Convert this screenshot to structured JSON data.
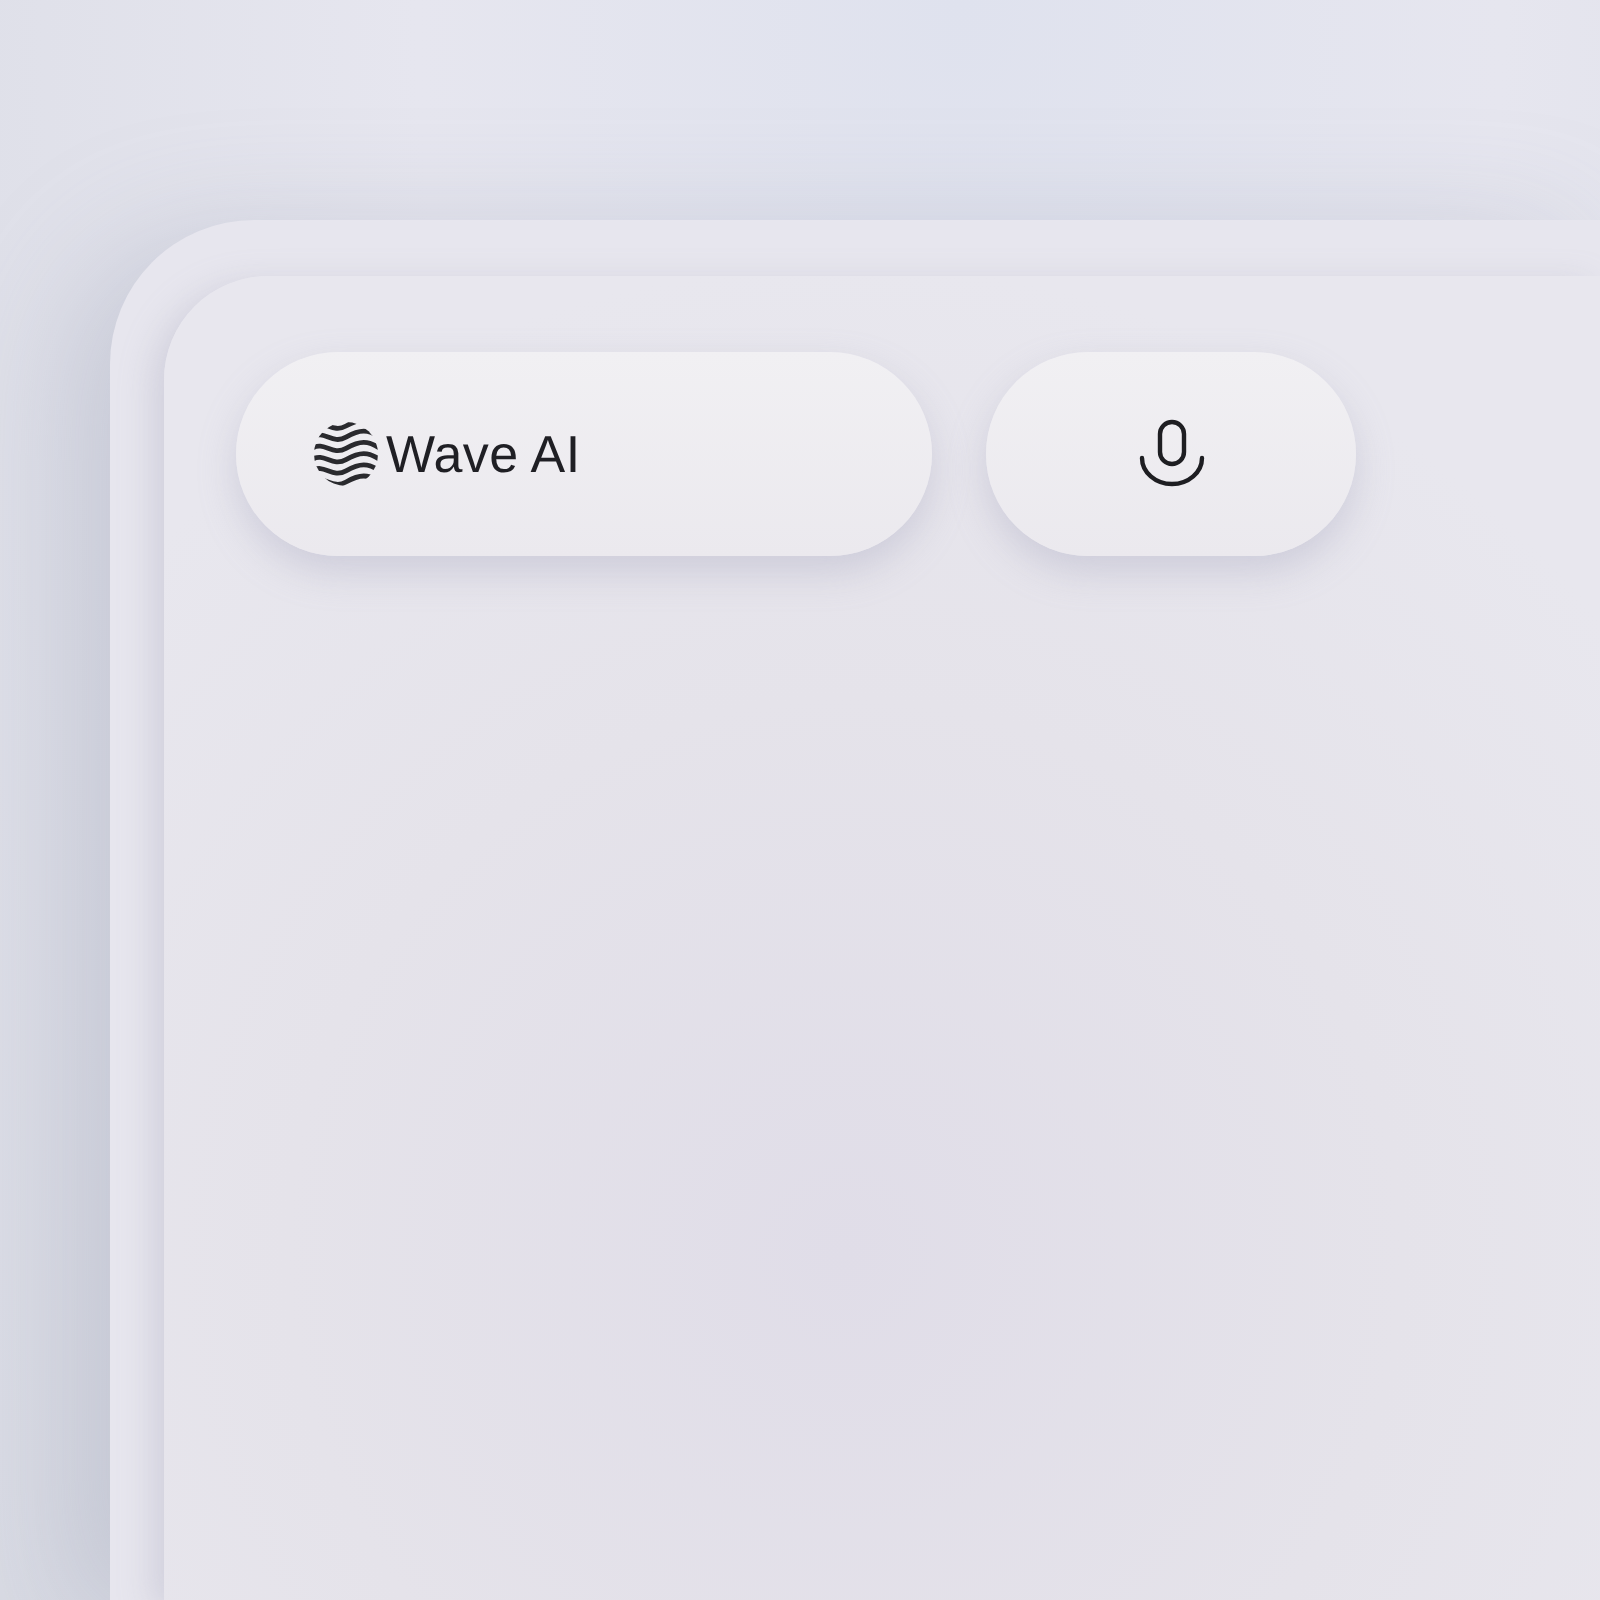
{
  "assistant_pill": {
    "label": "Wave AI"
  },
  "buttons": [
    {
      "kind": "microphone"
    }
  ]
}
